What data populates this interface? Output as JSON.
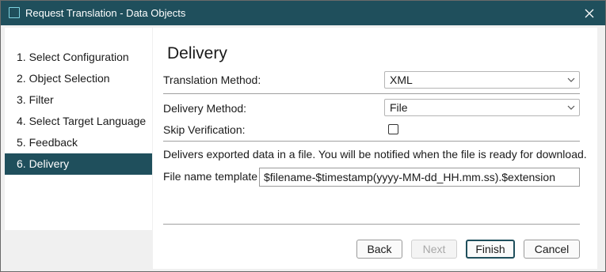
{
  "window": {
    "title": "Request Translation - Data Objects"
  },
  "sidebar": {
    "steps": [
      {
        "label": "1. Select Configuration"
      },
      {
        "label": "2. Object Selection"
      },
      {
        "label": "3. Filter"
      },
      {
        "label": "4. Select Target Language"
      },
      {
        "label": "5. Feedback"
      },
      {
        "label": "6. Delivery",
        "active": true
      }
    ]
  },
  "main": {
    "heading": "Delivery",
    "translation_method": {
      "label": "Translation Method:",
      "value": "XML"
    },
    "delivery_method": {
      "label": "Delivery Method:",
      "value": "File"
    },
    "skip_verification": {
      "label": "Skip Verification:",
      "checked": false
    },
    "description": "Delivers exported data in a file. You will be notified when the file is ready for download.",
    "file_name_template": {
      "label": "File name template",
      "value": "$filename-$timestamp(yyyy-MM-dd_HH.mm.ss).$extension"
    }
  },
  "buttons": {
    "back": "Back",
    "next": "Next",
    "finish": "Finish",
    "cancel": "Cancel"
  },
  "colors": {
    "accent": "#1f4f5c"
  }
}
